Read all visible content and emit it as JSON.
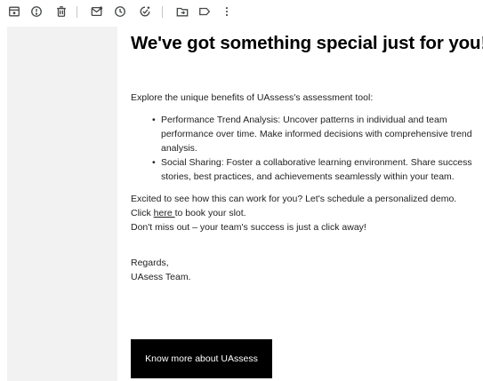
{
  "toolbar": {
    "icons": [
      "archive-icon",
      "report-spam-icon",
      "delete-icon",
      "mark-unread-icon",
      "snooze-icon",
      "add-task-icon",
      "move-to-icon",
      "label-icon",
      "more-vert-icon"
    ],
    "icon_color": "#444746"
  },
  "email": {
    "headline": "We've got something special just for you!",
    "intro": "Explore the unique benefits of UAssess's assessment tool:",
    "benefits": [
      "Performance Trend Analysis: Uncover patterns in individual and team performance over time. Make informed decisions with comprehensive trend analysis.",
      "Social Sharing: Foster a collaborative learning environment. Share success stories, best practices, and achievements seamlessly within your team."
    ],
    "demo_prefix": "Excited to see how this can work for you? Let's schedule a personalized demo. Click",
    "demo_link": "here ",
    "demo_suffix": "to book your slot.",
    "closing_line": "Don't miss out – your team's success is just a click away!",
    "regards": "Regards,",
    "team": "UAsess Team.",
    "cta_label": "Know more about UAssess"
  }
}
